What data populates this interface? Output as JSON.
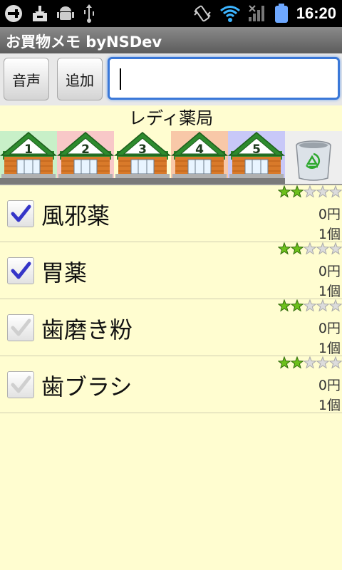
{
  "status_bar": {
    "time": "16:20",
    "left_icons": [
      "usb-icon",
      "download-icon",
      "android-icon",
      "usb-debug-icon"
    ],
    "right_icons": [
      "vibrate-icon",
      "wifi-icon",
      "signal-icon",
      "battery-icon"
    ]
  },
  "app": {
    "title": "お買物メモ byNSDev"
  },
  "toolbar": {
    "voice_label": "音声",
    "add_label": "追加",
    "input_value": ""
  },
  "store": {
    "name": "レディ薬局"
  },
  "stores": [
    {
      "number": "1",
      "color": "#c8f0c8"
    },
    {
      "number": "2",
      "color": "#f8c8c8"
    },
    {
      "number": "3",
      "color": "#fffdd0"
    },
    {
      "number": "4",
      "color": "#f8c8a8"
    },
    {
      "number": "5",
      "color": "#c8c8f8"
    }
  ],
  "trash_icon": "recycle-bin-icon",
  "items": [
    {
      "name": "風邪薬",
      "checked": true,
      "rating": 2,
      "rating_max": 5,
      "price": "0円",
      "qty": "1個"
    },
    {
      "name": "胃薬",
      "checked": true,
      "rating": 2,
      "rating_max": 5,
      "price": "0円",
      "qty": "1個"
    },
    {
      "name": "歯磨き粉",
      "checked": false,
      "rating": 2,
      "rating_max": 5,
      "price": "0円",
      "qty": "1個"
    },
    {
      "name": "歯ブラシ",
      "checked": false,
      "rating": 2,
      "rating_max": 5,
      "price": "0円",
      "qty": "1個"
    }
  ],
  "colors": {
    "accent": "#3a78d8",
    "background": "#fffdd0",
    "check": "#3535c8",
    "star": "#6cc01c"
  }
}
